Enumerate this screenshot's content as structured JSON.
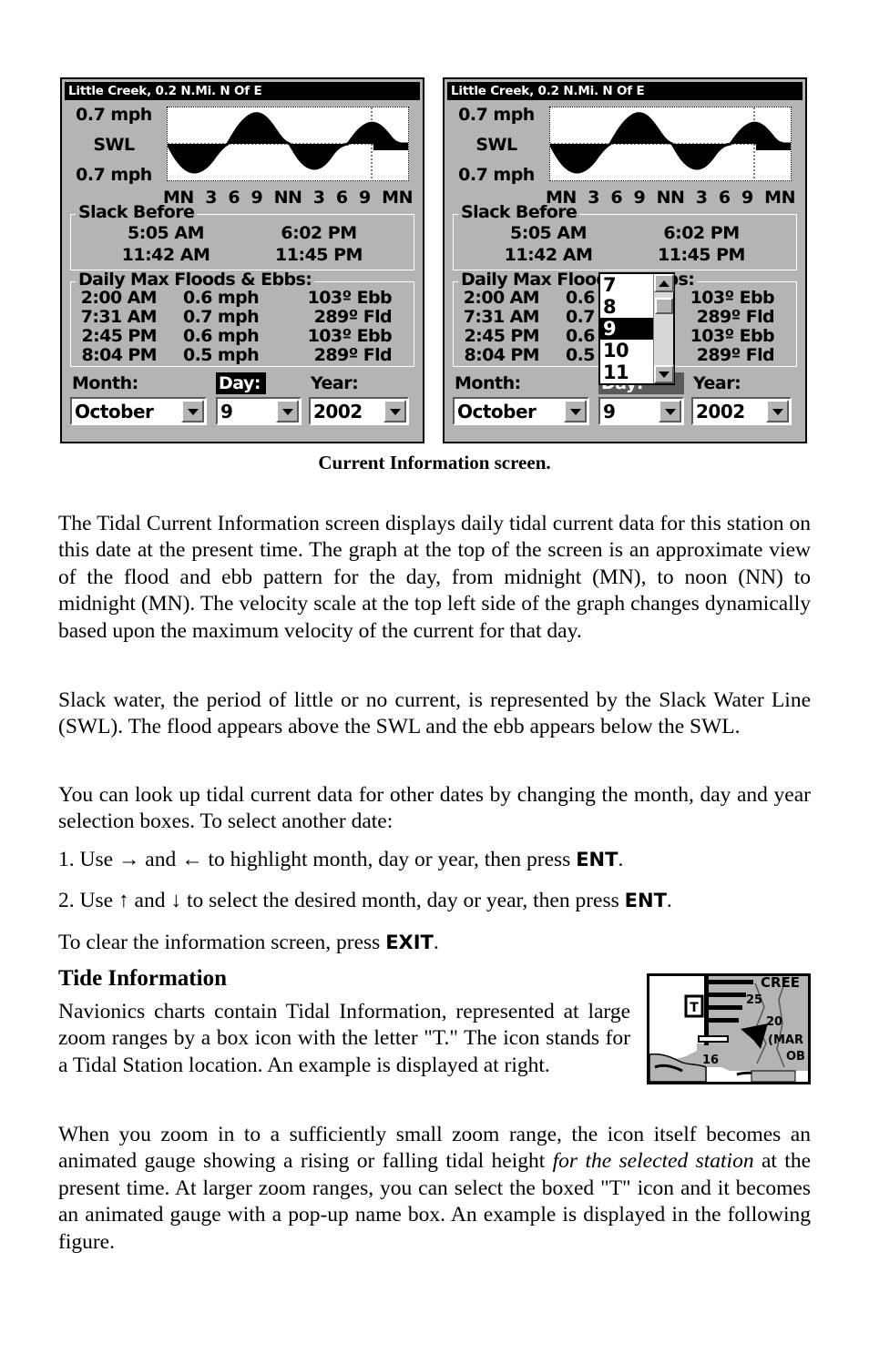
{
  "figure": {
    "caption": "Current Information screen.",
    "screens": [
      {
        "id": "left",
        "title": "Little Creek, 0.2 N.Mi. N Of E",
        "graph": {
          "scale_top": "0.7 mph",
          "scale_mid": "SWL",
          "scale_bottom": "0.7 mph",
          "ticks": [
            "MN",
            "3",
            "6",
            "9",
            "NN",
            "3",
            "6",
            "9",
            "MN"
          ]
        },
        "slack_before": {
          "title": "Slack Before",
          "rows": [
            [
              "5:05 AM",
              "6:02 PM"
            ],
            [
              "11:42 AM",
              "11:45 PM"
            ]
          ]
        },
        "floods_ebbs": {
          "title": "Daily Max Floods & Ebbs:",
          "rows": [
            {
              "time": "2:00 AM",
              "speed": "0.6 mph",
              "dir": "103º Ebb"
            },
            {
              "time": "7:31 AM",
              "speed": "0.7 mph",
              "dir": "289º Fld"
            },
            {
              "time": "2:45 PM",
              "speed": "0.6 mph",
              "dir": "103º Ebb"
            },
            {
              "time": "8:04 PM",
              "speed": "0.5 mph",
              "dir": "289º Fld"
            }
          ]
        },
        "selectors": {
          "month": {
            "label": "Month:",
            "value": "October"
          },
          "day": {
            "label": "Day:",
            "value": "9"
          },
          "year": {
            "label": "Year:",
            "value": "2002"
          }
        },
        "dropdown_open": false
      },
      {
        "id": "right",
        "title": "Little Creek, 0.2 N.Mi. N Of E",
        "graph": {
          "scale_top": "0.7 mph",
          "scale_mid": "SWL",
          "scale_bottom": "0.7 mph",
          "ticks": [
            "MN",
            "3",
            "6",
            "9",
            "NN",
            "3",
            "6",
            "9",
            "MN"
          ]
        },
        "slack_before": {
          "title": "Slack Before",
          "rows": [
            [
              "5:05 AM",
              "6:02 PM"
            ],
            [
              "11:42 AM",
              "11:45 PM"
            ]
          ]
        },
        "floods_ebbs": {
          "title": "Daily Max Floods & Ebbs:",
          "rows": [
            {
              "time": "2:00 AM",
              "speed": "0.6 mph",
              "dir": "103º Ebb"
            },
            {
              "time": "7:31 AM",
              "speed": "0.7 mph",
              "dir": "289º Fld"
            },
            {
              "time": "2:45 PM",
              "speed": "0.6 mph",
              "dir": "103º Ebb"
            },
            {
              "time": "8:04 PM",
              "speed": "0.5 mph",
              "dir": "289º Fld"
            }
          ]
        },
        "selectors": {
          "month": {
            "label": "Month:",
            "value": "October"
          },
          "day": {
            "label": "Day:",
            "value": "9"
          },
          "year": {
            "label": "Year:",
            "value": "2002"
          }
        },
        "dropdown_open": true,
        "dropdown": {
          "options": [
            "7",
            "8",
            "9",
            "10",
            "11"
          ],
          "selected": "9"
        }
      }
    ]
  },
  "body": {
    "p1": "The Tidal Current Information screen displays daily tidal current data for this station on this date at the present time. The graph at the top of the screen is an approximate view of the flood and ebb pattern for the day, from midnight (MN), to noon (NN) to midnight (MN). The velocity scale at the top left side of the graph changes dynamically based upon the maximum velocity of the current for that day.",
    "p2": "Slack water, the period of little or no current, is represented by the Slack Water Line (SWL). The flood appears above the SWL and the ebb appears below the SWL.",
    "p3": "You can look up tidal current data for other dates by changing the month, day and year selection boxes. To select another date:",
    "list_item_1": {
      "prefix": "1. Use ",
      "arrow_a": "→",
      "mid": " and ",
      "arrow_b": "←",
      "text": " to highlight month, day or year, then press ",
      "key": "ENT",
      "suffix": "."
    },
    "list_item_2": {
      "prefix": "2. Use ",
      "arrow_a": "↑",
      "mid": " and ",
      "arrow_b": "↓",
      "text": " to select the desired month, day or year, then press ",
      "key": "ENT",
      "suffix": "."
    },
    "p4": {
      "text": "To clear the information screen, press ",
      "key": "EXIT",
      "suffix": "."
    },
    "heading": "Tide Information",
    "p5": "Navionics charts contain Tidal Information, represented at large zoom ranges by a box icon with the letter \"T.\" The icon stands for a Tidal Station location. An example is displayed at right.",
    "p6": {
      "part1": "When you zoom in to a sufficiently small zoom range, the icon itself becomes an animated gauge showing a rising or falling tidal height ",
      "italic": "for the selected station",
      "part2": " at the present time. At larger zoom ranges, you can select the boxed \"T\" icon and it becomes an animated gauge with a pop-up name box. An example is displayed in the following figure."
    }
  },
  "chart_thumbnail": {
    "tidal_station_icon_letter": "T",
    "depth_labels": [
      "25",
      "20",
      "16"
    ],
    "place_labels": [
      "CREE",
      "(MAR",
      "OB"
    ]
  },
  "colors": {
    "device_background": "#b4b4b4",
    "titlebar_background": "#000000",
    "titlebar_text": "#ffffff",
    "graph_background": "#ffffff",
    "selected_highlight": "#000000",
    "inactive_highlight": "#5a5a5a",
    "page_background": "#ffffff",
    "text": "#000000"
  }
}
